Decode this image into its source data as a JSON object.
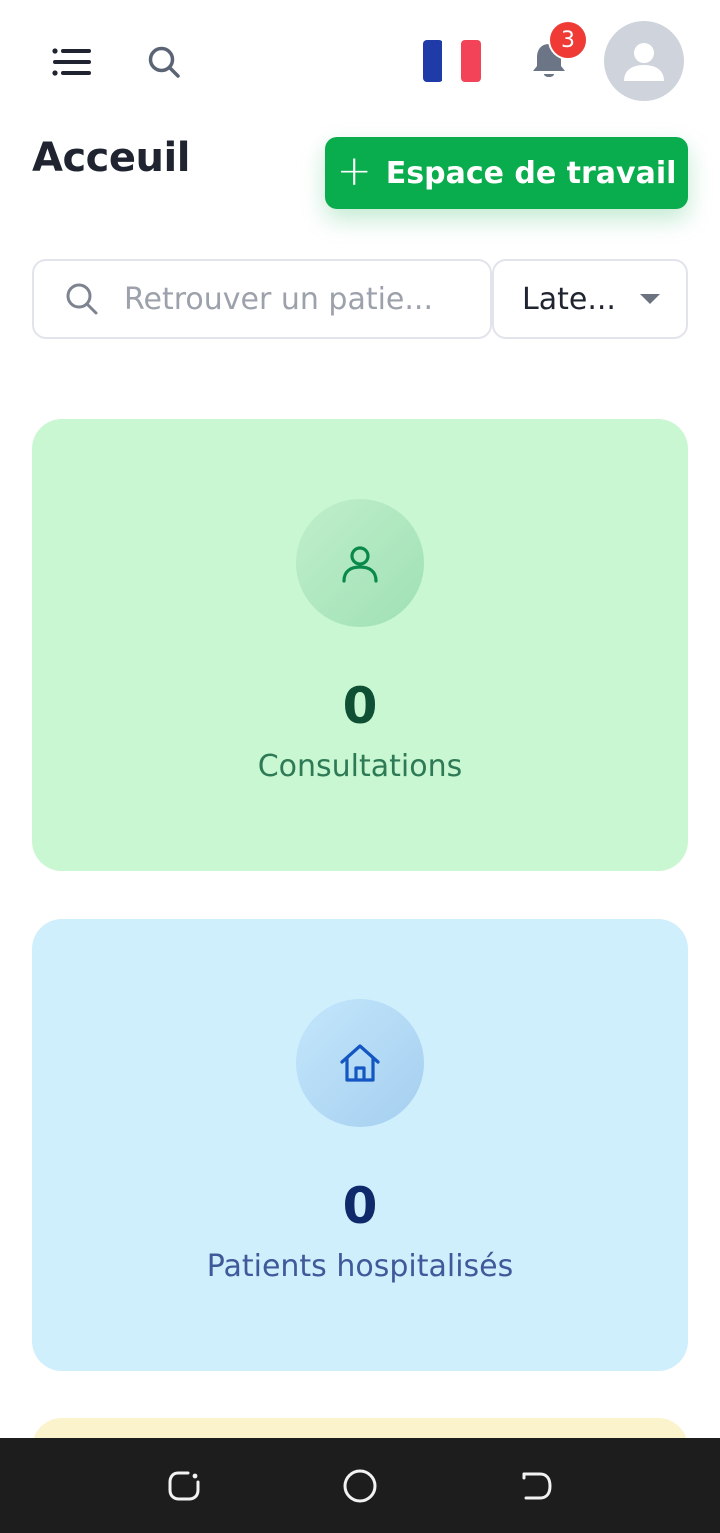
{
  "header": {
    "menu_icon": "hamburger-menu-icon",
    "search_icon": "search-icon",
    "language_flag": "french-flag",
    "notification_icon": "bell-icon",
    "notification_count": "3",
    "avatar_icon": "user-avatar-icon"
  },
  "page": {
    "title": "Acceuil",
    "workspace_button": {
      "plus": "+",
      "label": "Espace de travail"
    }
  },
  "filters": {
    "search_placeholder": "Retrouver un patie...",
    "select_value": "Late..."
  },
  "cards": [
    {
      "count": "0",
      "label": "Consultations",
      "icon": "user-icon",
      "color": "#c8f7d1"
    },
    {
      "count": "0",
      "label": "Patients hospitalisés",
      "icon": "home-icon",
      "color": "#d0effc"
    }
  ],
  "system_nav": {
    "back_icon": "recent-apps-icon",
    "home_icon": "home-circle-icon",
    "recent_icon": "back-icon"
  },
  "colors": {
    "accent": "#0aad4d",
    "badge": "#ef3a35"
  }
}
